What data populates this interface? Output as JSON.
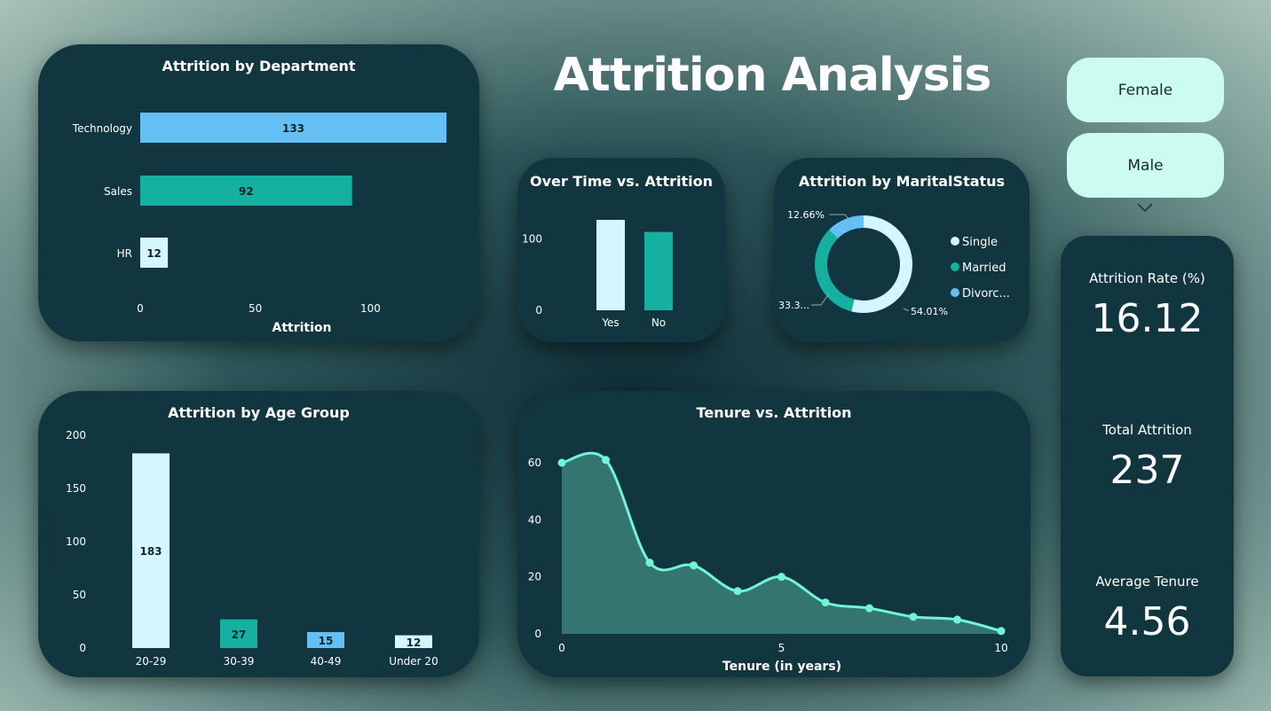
{
  "title": "Attrition Analysis",
  "slicers": {
    "female": "Female",
    "male": "Male"
  },
  "kpis": {
    "attrition_rate_label": "Attrition Rate (%)",
    "attrition_rate_value": "16.12",
    "total_attrition_label": "Total Attrition",
    "total_attrition_value": "237",
    "avg_tenure_label": "Average Tenure",
    "avg_tenure_value": "4.56"
  },
  "colors": {
    "light": "#d4f6ff",
    "teal": "#16b0a0",
    "blue": "#64c0f4",
    "mint": "#6ff5d8",
    "card": "#12363f"
  },
  "chart_data": [
    {
      "id": "department",
      "type": "bar",
      "title": "Attrition by Department",
      "categories": [
        "Technology",
        "Sales",
        "HR"
      ],
      "values": [
        133,
        92,
        12
      ],
      "bar_colors": [
        "#64c0f4",
        "#16b0a0",
        "#d4f6ff"
      ],
      "xlabel": "Attrition",
      "xlim": [
        0,
        133
      ],
      "xticks": [
        "0",
        "50",
        "100"
      ],
      "orientation": "horizontal"
    },
    {
      "id": "overtime",
      "type": "bar",
      "title": "Over Time vs. Attrition",
      "categories": [
        "Yes",
        "No"
      ],
      "values": [
        127,
        110
      ],
      "bar_colors": [
        "#d4f6ff",
        "#16b0a0"
      ],
      "ylim": [
        0,
        127
      ],
      "yticks": [
        "0",
        "100"
      ]
    },
    {
      "id": "marital",
      "type": "pie",
      "title": "Attrition by MaritalStatus",
      "labels": [
        "Single",
        "Married",
        "Divorc..."
      ],
      "values": [
        54.01,
        33.33,
        12.66
      ],
      "slice_labels": [
        "54.01%",
        "33.3...",
        "12.66%"
      ],
      "colors": [
        "#d4f6ff",
        "#16b0a0",
        "#64c0f4"
      ],
      "legend": "right"
    },
    {
      "id": "agegroup",
      "type": "bar",
      "title": "Attrition by Age Group",
      "categories": [
        "20-29",
        "30-39",
        "40-49",
        "Under 20"
      ],
      "values": [
        183,
        27,
        15,
        12
      ],
      "bar_colors": [
        "#d4f6ff",
        "#16b0a0",
        "#64c0f4",
        "#d4f6ff"
      ],
      "ylabel": "Attrition",
      "ylim": [
        0,
        200
      ],
      "yticks": [
        "0",
        "50",
        "100",
        "150",
        "200"
      ]
    },
    {
      "id": "tenure",
      "type": "area",
      "title": "Tenure vs. Attrition",
      "xlabel": "Tenure (in years)",
      "x": [
        0,
        1,
        2,
        3,
        4,
        5,
        6,
        7,
        8,
        9,
        10
      ],
      "y": [
        60,
        61,
        25,
        24,
        15,
        20,
        11,
        9,
        6,
        5,
        1
      ],
      "xlim": [
        0,
        10
      ],
      "ylim": [
        0,
        60
      ],
      "xticks": [
        "0",
        "5",
        "10"
      ],
      "yticks": [
        "0",
        "20",
        "40",
        "60"
      ]
    }
  ]
}
